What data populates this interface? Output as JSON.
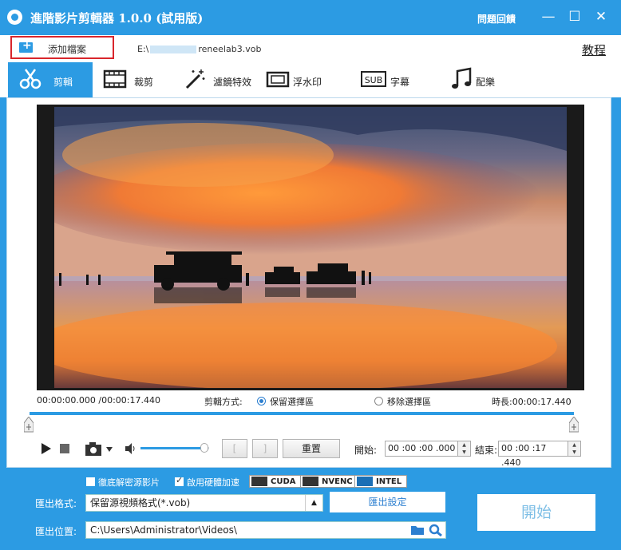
{
  "window": {
    "title": "進階影片剪輯器 1.0.0 (試用版)",
    "feedback_label": "問題回饋",
    "min_glyph": "—",
    "max_glyph": "☐",
    "close_glyph": "✕"
  },
  "filebar": {
    "add_file_label": "添加檔案",
    "file_path_prefix": "E:\\",
    "file_path_suffix": "reneelab3.vob",
    "tutorial_label": "教程"
  },
  "tabs": [
    {
      "label": "剪輯",
      "icon": "scissors-icon",
      "active": true
    },
    {
      "label": "裁剪",
      "icon": "film-crop-icon",
      "active": false
    },
    {
      "label": "濾鏡特效",
      "icon": "magic-wand-icon",
      "active": false
    },
    {
      "label": "浮水印",
      "icon": "watermark-icon",
      "active": false
    },
    {
      "label": "字幕",
      "icon": "subtitle-icon",
      "active": false
    },
    {
      "label": "配樂",
      "icon": "music-note-icon",
      "active": false
    }
  ],
  "subtitle_icon_text": "SUB",
  "timeline": {
    "range_text": "00:00:00.000 /00:00:17.440",
    "cut_mode_label": "剪輯方式:",
    "keep_option": "保留選擇區",
    "remove_option": "移除選擇區",
    "duration_label": "時長:",
    "duration_value": "00:00:17.440",
    "selected_mode": "keep"
  },
  "controls": {
    "bracket_left": "[",
    "bracket_right": "]",
    "reset_label": "重置",
    "start_label": "開始:",
    "start_value": "00 :00 :00 .000",
    "end_label": "結束:",
    "end_value": "00 :00 :17 .440",
    "volume_level": 0.97
  },
  "export": {
    "decompress_label": "徹底解密源影片",
    "decompress_checked": false,
    "hw_accel_label": "啟用硬體加速",
    "hw_accel_checked": true,
    "gpu_badges": [
      "CUDA",
      "NVENC",
      "INTEL"
    ],
    "format_label": "匯出格式:",
    "format_value": "保留源視頻格式(*.vob)",
    "settings_label": "匯出設定",
    "location_label": "匯出位置:",
    "location_value": "C:\\Users\\Administrator\\Videos\\",
    "start_label": "開始"
  },
  "colors": {
    "accent": "#2c9be3",
    "highlight_border": "#d9262c"
  }
}
